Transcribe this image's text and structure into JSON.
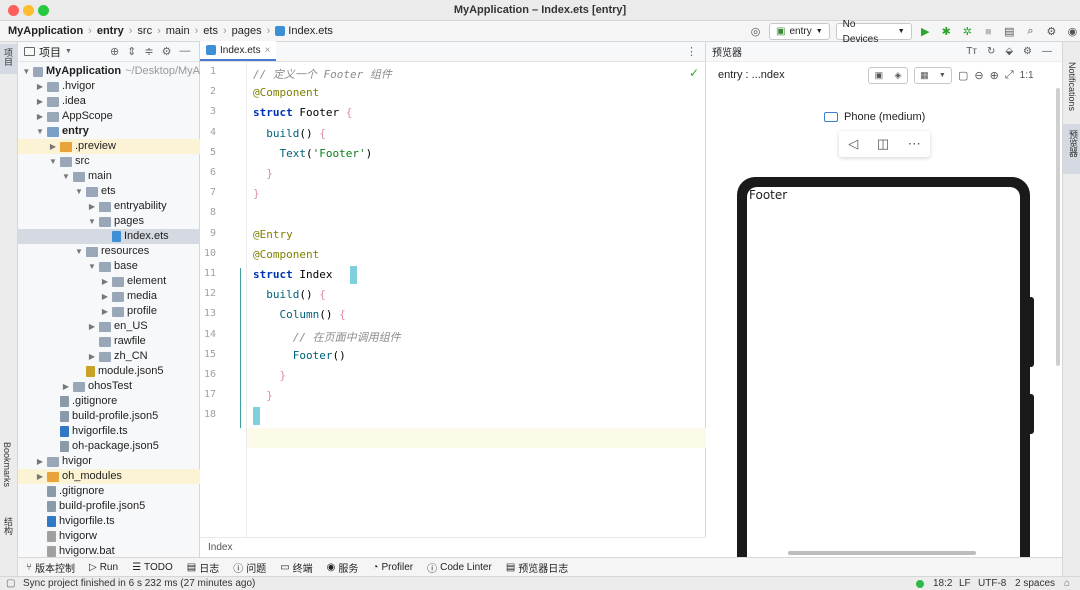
{
  "window": {
    "title": "MyApplication – Index.ets [entry]"
  },
  "breadcrumb": [
    "MyApplication",
    "entry",
    "src",
    "main",
    "ets",
    "pages",
    "Index.ets"
  ],
  "toolbar": {
    "module_select": "entry",
    "device_select": "No Devices"
  },
  "left_strip": {
    "project_label": "项目",
    "bookmarks_label": "Bookmarks",
    "structure_label": "结构"
  },
  "project_panel": {
    "title": "项目",
    "tree": [
      {
        "label": "MyApplication",
        "suffix": "~/Desktop/MyA",
        "depth": 0,
        "arrow": "open",
        "icon": "folder",
        "bold": true
      },
      {
        "label": ".hvigor",
        "depth": 1,
        "arrow": "closed",
        "icon": "folder"
      },
      {
        "label": ".idea",
        "depth": 1,
        "arrow": "closed",
        "icon": "folder"
      },
      {
        "label": "AppScope",
        "depth": 1,
        "arrow": "closed",
        "icon": "folder"
      },
      {
        "label": "entry",
        "depth": 1,
        "arrow": "open",
        "icon": "module-folder",
        "bold": true
      },
      {
        "label": ".preview",
        "depth": 2,
        "arrow": "closed",
        "icon": "orange-folder",
        "highlight": true
      },
      {
        "label": "src",
        "depth": 2,
        "arrow": "open",
        "icon": "folder"
      },
      {
        "label": "main",
        "depth": 3,
        "arrow": "open",
        "icon": "folder"
      },
      {
        "label": "ets",
        "depth": 4,
        "arrow": "open",
        "icon": "folder"
      },
      {
        "label": "entryability",
        "depth": 5,
        "arrow": "closed",
        "icon": "folder"
      },
      {
        "label": "pages",
        "depth": 5,
        "arrow": "open",
        "icon": "folder"
      },
      {
        "label": "Index.ets",
        "depth": 6,
        "arrow": "none",
        "icon": "ets-file",
        "selected": true
      },
      {
        "label": "resources",
        "depth": 4,
        "arrow": "open",
        "icon": "folder"
      },
      {
        "label": "base",
        "depth": 5,
        "arrow": "open",
        "icon": "folder"
      },
      {
        "label": "element",
        "depth": 6,
        "arrow": "closed",
        "icon": "folder"
      },
      {
        "label": "media",
        "depth": 6,
        "arrow": "closed",
        "icon": "folder"
      },
      {
        "label": "profile",
        "depth": 6,
        "arrow": "closed",
        "icon": "folder"
      },
      {
        "label": "en_US",
        "depth": 5,
        "arrow": "closed",
        "icon": "folder"
      },
      {
        "label": "rawfile",
        "depth": 5,
        "arrow": "none",
        "icon": "folder"
      },
      {
        "label": "zh_CN",
        "depth": 5,
        "arrow": "closed",
        "icon": "folder"
      },
      {
        "label": "module.json5",
        "depth": 4,
        "arrow": "none",
        "icon": "json-file"
      },
      {
        "label": "ohosTest",
        "depth": 3,
        "arrow": "closed",
        "icon": "folder"
      },
      {
        "label": ".gitignore",
        "depth": 2,
        "arrow": "none",
        "icon": "config-file"
      },
      {
        "label": "build-profile.json5",
        "depth": 2,
        "arrow": "none",
        "icon": "config-file"
      },
      {
        "label": "hvigorfile.ts",
        "depth": 2,
        "arrow": "none",
        "icon": "ts-file"
      },
      {
        "label": "oh-package.json5",
        "depth": 2,
        "arrow": "none",
        "icon": "config-file"
      },
      {
        "label": "hvigor",
        "depth": 1,
        "arrow": "closed",
        "icon": "folder"
      },
      {
        "label": "oh_modules",
        "depth": 1,
        "arrow": "closed",
        "icon": "orange-folder",
        "highlight": true
      },
      {
        "label": ".gitignore",
        "depth": 1,
        "arrow": "none",
        "icon": "config-file"
      },
      {
        "label": "build-profile.json5",
        "depth": 1,
        "arrow": "none",
        "icon": "config-file"
      },
      {
        "label": "hvigorfile.ts",
        "depth": 1,
        "arrow": "none",
        "icon": "ts-file"
      },
      {
        "label": "hvigorw",
        "depth": 1,
        "arrow": "none",
        "icon": "plain-file"
      },
      {
        "label": "hvigorw.bat",
        "depth": 1,
        "arrow": "none",
        "icon": "plain-file"
      }
    ]
  },
  "editor": {
    "tab_label": "Index.ets",
    "footer_label": "Index",
    "line_numbers": [
      "1",
      "2",
      "3",
      "4",
      "5",
      "6",
      "7",
      "8",
      "9",
      "10",
      "11",
      "12",
      "13",
      "14",
      "15",
      "16",
      "17",
      "18"
    ],
    "lines": [
      [
        [
          "cm",
          "// 定义一个 Footer 组件"
        ]
      ],
      [
        [
          "an",
          "@Component"
        ]
      ],
      [
        [
          "kw",
          "struct"
        ],
        [
          "typ",
          " Footer "
        ],
        [
          "brace",
          "{"
        ]
      ],
      [
        [
          "typ",
          "  "
        ],
        [
          "fn",
          "build"
        ],
        [
          "typ",
          "() "
        ],
        [
          "brace",
          "{"
        ]
      ],
      [
        [
          "typ",
          "    "
        ],
        [
          "fn",
          "Text"
        ],
        [
          "typ",
          "("
        ],
        [
          "str",
          "'Footer'"
        ],
        [
          "typ",
          ")"
        ]
      ],
      [
        [
          "typ",
          "  "
        ],
        [
          "brace",
          "}"
        ]
      ],
      [
        [
          "brace",
          "}"
        ]
      ],
      [],
      [
        [
          "an",
          "@Entry"
        ]
      ],
      [
        [
          "an",
          "@Component"
        ]
      ],
      [
        [
          "kw",
          "struct"
        ],
        [
          "typ",
          " Index "
        ]
      ],
      [
        [
          "typ",
          "  "
        ],
        [
          "fn",
          "build"
        ],
        [
          "typ",
          "() "
        ],
        [
          "brace",
          "{"
        ]
      ],
      [
        [
          "typ",
          "    "
        ],
        [
          "fn",
          "Column"
        ],
        [
          "typ",
          "() "
        ],
        [
          "brace",
          "{"
        ]
      ],
      [
        [
          "cm",
          "      // 在页面中调用组件"
        ]
      ],
      [
        [
          "typ",
          "      "
        ],
        [
          "fn",
          "Footer"
        ],
        [
          "typ",
          "()"
        ]
      ],
      [
        [
          "typ",
          "    "
        ],
        [
          "brace",
          "}"
        ]
      ],
      [
        [
          "typ",
          "  "
        ],
        [
          "brace",
          "}"
        ]
      ],
      []
    ]
  },
  "preview": {
    "panel_title": "预览器",
    "target_label": "entry : ...ndex",
    "device_name": "Phone (medium)",
    "rendered_text": "Footer"
  },
  "right_strip": {
    "notifications_label": "Notifications",
    "previewer_label": "预览器"
  },
  "bottom_tools": [
    "版本控制",
    "Run",
    "TODO",
    "日志",
    "问题",
    "终端",
    "服务",
    "Profiler",
    "Code Linter",
    "预览器日志"
  ],
  "status": {
    "message": "Sync project finished in 6 s 232 ms (27 minutes ago)",
    "position": "18:2",
    "line_sep": "LF",
    "encoding": "UTF-8",
    "indent": "2 spaces"
  },
  "colors": {
    "accent": "#4a7bd0",
    "selection": "#d4d9e2",
    "highlight": "#fbf3d4",
    "caret": "#7fd0dc"
  }
}
